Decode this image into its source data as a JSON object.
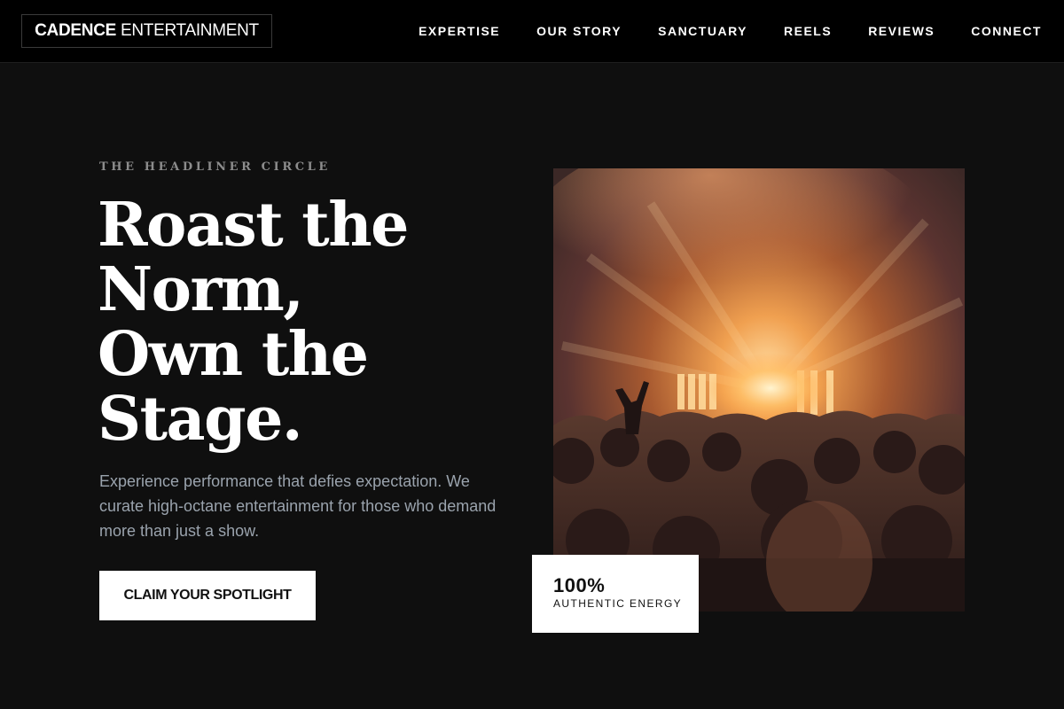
{
  "brand": {
    "bold": "CADENCE",
    "light": "ENTERTAINMENT"
  },
  "nav": {
    "items": [
      {
        "label": "EXPERTISE"
      },
      {
        "label": "OUR STORY"
      },
      {
        "label": "SANCTUARY"
      },
      {
        "label": "REELS"
      },
      {
        "label": "REVIEWS"
      },
      {
        "label": "CONNECT"
      }
    ]
  },
  "hero": {
    "eyebrow": "THE HEADLINER CIRCLE",
    "headline_lines": [
      "Roast the",
      "Norm,",
      "Own the",
      "Stage."
    ],
    "lede": "Experience performance that defies expectation. We curate high-octane entertainment for those who demand more than just a show.",
    "cta_label": "CLAIM YOUR SPOTLIGHT"
  },
  "stat": {
    "value": "100%",
    "label": "AUTHENTIC ENERGY"
  },
  "colors": {
    "background": "#0f0f0f",
    "header": "#000000",
    "accent_light": "#ffffff",
    "muted_text": "#9aa3ad",
    "photo_glow": "#f0a050"
  },
  "icons": {
    "photo": "concert-crowd-image"
  }
}
